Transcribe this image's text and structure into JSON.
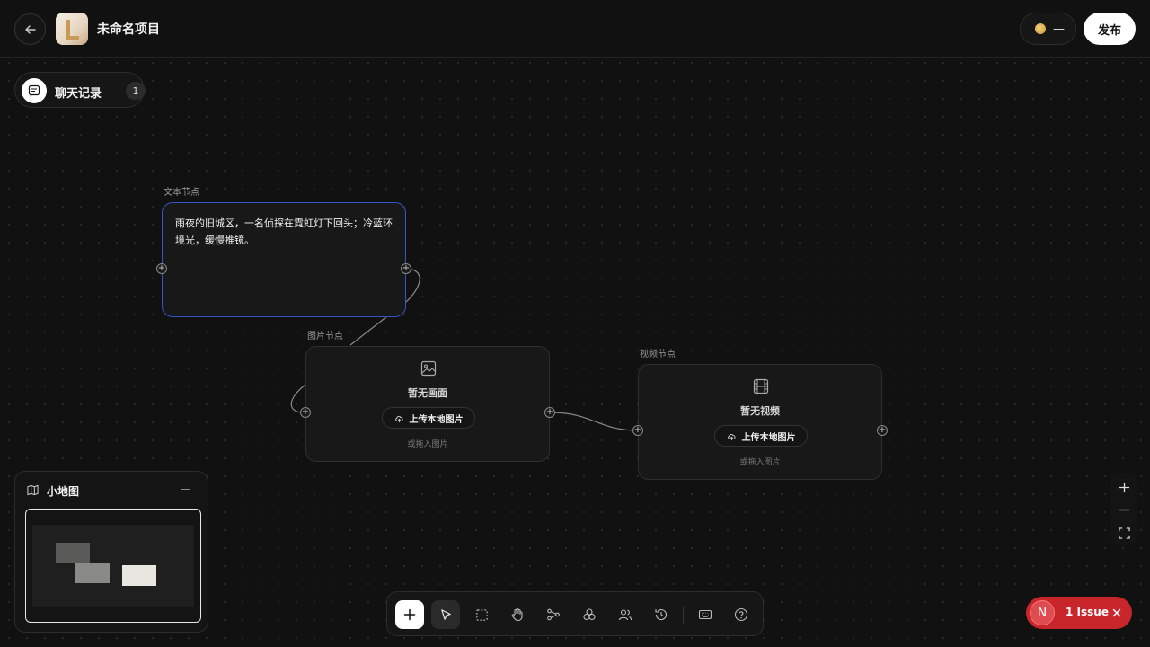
{
  "header": {
    "project_title": "未命名项目",
    "credits_value": "—",
    "publish_label": "发布"
  },
  "chat": {
    "label": "聊天记录",
    "count": "1"
  },
  "nodes": {
    "text_node": {
      "label": "文本节点",
      "content": "雨夜的旧城区，一名侦探在霓虹灯下回头；冷蓝环境光，缓慢推镜。"
    },
    "image_node": {
      "label": "图片节点",
      "empty_title": "暂无画面",
      "upload_label": "上传本地图片",
      "drop_hint": "或拖入图片"
    },
    "video_node": {
      "label": "视频节点",
      "empty_title": "暂无视频",
      "upload_label": "上传本地图片",
      "drop_hint": "或拖入图片"
    }
  },
  "minimap": {
    "title": "小地图"
  },
  "toolbar": {
    "tools": [
      "add-icon",
      "select-pointer-icon",
      "marquee-select-icon",
      "hand-pan-icon",
      "connect-nodes-icon",
      "group-icon",
      "users-icon",
      "history-icon",
      "keyboard-icon",
      "help-icon"
    ]
  },
  "issue": {
    "logo_letter": "N",
    "text": "1 Issue"
  },
  "colors": {
    "canvas_bg": "#111111",
    "selected_border": "#3554c8",
    "issue_red": "#c9262b",
    "coin_gold": "#d9a83e"
  }
}
